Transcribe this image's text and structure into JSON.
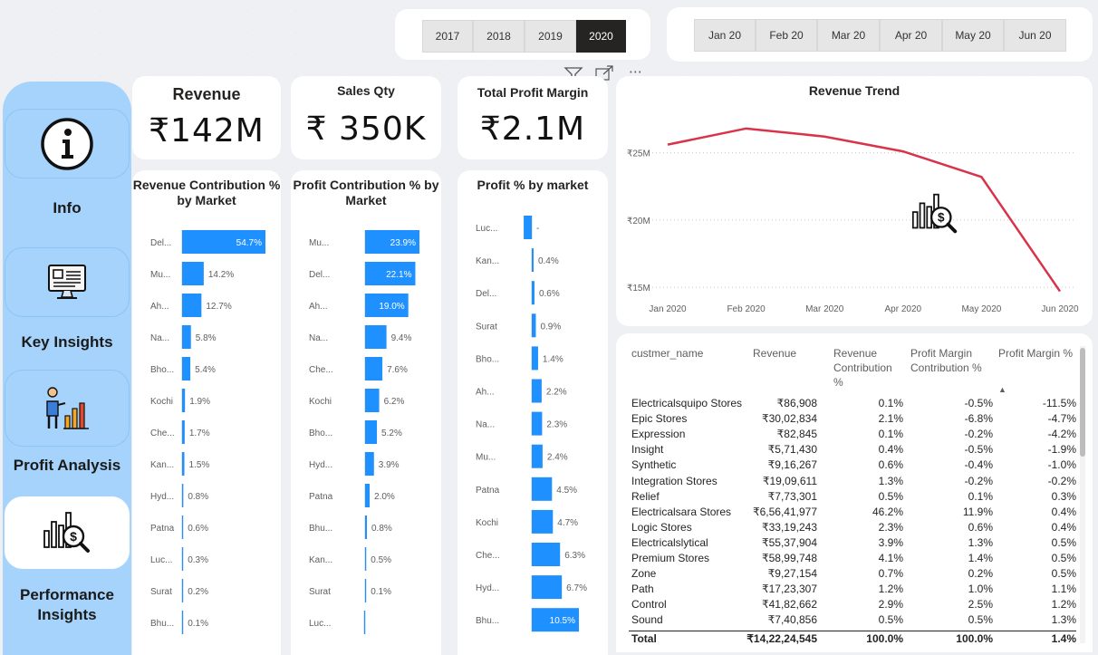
{
  "slicers": {
    "years": [
      "2017",
      "2018",
      "2019",
      "2020"
    ],
    "selected_year": "2020",
    "months": [
      "Jan 20",
      "Feb 20",
      "Mar 20",
      "Apr 20",
      "May 20",
      "Jun 20"
    ]
  },
  "nav": {
    "items": [
      {
        "label": "Info",
        "icon": "info-icon"
      },
      {
        "label": "Key Insights",
        "icon": "monitor-report-icon"
      },
      {
        "label": "Profit Analysis",
        "icon": "presenter-chart-icon"
      },
      {
        "label": "Performance Insights",
        "icon": "chart-magnifier-icon"
      }
    ],
    "active": "Performance Insights"
  },
  "kpis": {
    "revenue": {
      "title": "Revenue",
      "value": "₹142M"
    },
    "sales_qty": {
      "title": "Sales Qty",
      "value": "₹ 350K"
    },
    "profit_margin": {
      "title": "Total Profit Margin",
      "value": "₹2.1M"
    }
  },
  "colors": {
    "bar": "#1e90ff",
    "line": "#d9334a",
    "nav": "#a6d3fb"
  },
  "chart_data": [
    {
      "type": "bar",
      "title": "Revenue Contribution % by Market",
      "categories": [
        "Del...",
        "Mu...",
        "Ah...",
        "Na...",
        "Bho...",
        "Kochi",
        "Che...",
        "Kan...",
        "Hyd...",
        "Patna",
        "Luc...",
        "Surat",
        "Bhu..."
      ],
      "values": [
        54.7,
        14.2,
        12.7,
        5.8,
        5.4,
        1.9,
        1.7,
        1.5,
        0.8,
        0.6,
        0.3,
        0.2,
        0.1
      ],
      "labels": [
        "54.7%",
        "14.2%",
        "12.7%",
        "5.8%",
        "5.4%",
        "1.9%",
        "1.7%",
        "1.5%",
        "0.8%",
        "0.6%",
        "0.3%",
        "0.2%",
        "0.1%"
      ],
      "max": 54.7
    },
    {
      "type": "bar",
      "title": "Profit Contribution % by Market",
      "categories": [
        "Mu...",
        "Del...",
        "Ah...",
        "Na...",
        "Che...",
        "Kochi",
        "Bho...",
        "Hyd...",
        "Patna",
        "Bhu...",
        "Kan...",
        "Surat",
        "Luc..."
      ],
      "values": [
        23.9,
        22.1,
        19.0,
        9.4,
        7.6,
        6.2,
        5.2,
        3.9,
        2.0,
        0.8,
        0.5,
        0.1,
        -0.4
      ],
      "labels": [
        "23.9%",
        "22.1%",
        "19.0%",
        "9.4%",
        "7.6%",
        "6.2%",
        "5.2%",
        "3.9%",
        "2.0%",
        "0.8%",
        "0.5%",
        "0.1%",
        ""
      ],
      "max": 23.9
    },
    {
      "type": "bar",
      "title": "Profit % by market",
      "categories": [
        "Luc...",
        "Kan...",
        "Del...",
        "Surat",
        "Bho...",
        "Ah...",
        "Na...",
        "Mu...",
        "Patna",
        "Kochi",
        "Che...",
        "Hyd...",
        "Bhu..."
      ],
      "values": [
        -1.8,
        0.4,
        0.6,
        0.9,
        1.4,
        2.2,
        2.3,
        2.4,
        4.5,
        4.7,
        6.3,
        6.7,
        10.5
      ],
      "labels": [
        "-",
        "0.4%",
        "0.6%",
        "0.9%",
        "1.4%",
        "2.2%",
        "2.3%",
        "2.4%",
        "4.5%",
        "4.7%",
        "6.3%",
        "6.7%",
        "10.5%"
      ],
      "max": 10.5
    },
    {
      "type": "line",
      "title": "Revenue Trend",
      "x": [
        "Jan 2020",
        "Feb 2020",
        "Mar 2020",
        "Apr 2020",
        "May 2020",
        "Jun 2020"
      ],
      "values": [
        25.6,
        26.8,
        26.2,
        25.1,
        23.2,
        14.7
      ],
      "yticks": [
        "₹25M",
        "₹20M",
        "₹15M"
      ],
      "ytick_values": [
        25,
        20,
        15
      ],
      "ylim": [
        14,
        28
      ]
    }
  ],
  "table": {
    "columns": [
      "custmer_name",
      "Revenue",
      "Revenue Contribution %",
      "Profit Margin Contribution %",
      "Profit Margin %"
    ],
    "rows": [
      [
        "Electricalsquipo Stores",
        "₹86,908",
        "0.1%",
        "-0.5%",
        "-11.5%"
      ],
      [
        "Epic Stores",
        "₹30,02,834",
        "2.1%",
        "-6.8%",
        "-4.7%"
      ],
      [
        "Expression",
        "₹82,845",
        "0.1%",
        "-0.2%",
        "-4.2%"
      ],
      [
        "Insight",
        "₹5,71,430",
        "0.4%",
        "-0.5%",
        "-1.9%"
      ],
      [
        "Synthetic",
        "₹9,16,267",
        "0.6%",
        "-0.4%",
        "-1.0%"
      ],
      [
        "Integration Stores",
        "₹19,09,611",
        "1.3%",
        "-0.2%",
        "-0.2%"
      ],
      [
        "Relief",
        "₹7,73,301",
        "0.5%",
        "0.1%",
        "0.3%"
      ],
      [
        "Electricalsara Stores",
        "₹6,56,41,977",
        "46.2%",
        "11.9%",
        "0.4%"
      ],
      [
        "Logic Stores",
        "₹33,19,243",
        "2.3%",
        "0.6%",
        "0.4%"
      ],
      [
        "Electricalslytical",
        "₹55,37,904",
        "3.9%",
        "1.3%",
        "0.5%"
      ],
      [
        "Premium Stores",
        "₹58,99,748",
        "4.1%",
        "1.4%",
        "0.5%"
      ],
      [
        "Zone",
        "₹9,27,154",
        "0.7%",
        "0.2%",
        "0.5%"
      ],
      [
        "Path",
        "₹17,23,307",
        "1.2%",
        "1.0%",
        "1.1%"
      ],
      [
        "Control",
        "₹41,82,662",
        "2.9%",
        "2.5%",
        "1.2%"
      ],
      [
        "Sound",
        "₹7,40,856",
        "0.5%",
        "0.5%",
        "1.3%"
      ]
    ],
    "total": [
      "Total",
      "₹14,22,24,545",
      "100.0%",
      "100.0%",
      "1.4%"
    ],
    "sort_indicator": "▲"
  },
  "header_icons": {
    "filter": "filter-icon",
    "focus": "focus-mode-icon",
    "more": "more-options-icon"
  }
}
